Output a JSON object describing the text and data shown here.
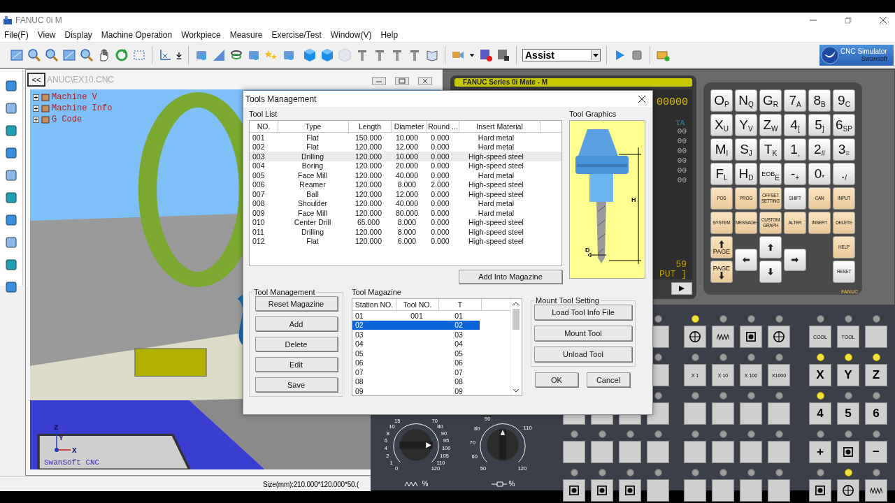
{
  "window": {
    "title": "FANUC 0i M"
  },
  "menu": [
    "File(F)",
    "View",
    "Display",
    "Machine Operation",
    "Workpiece",
    "Measure",
    "Exercise/Test",
    "Window(V)",
    "Help"
  ],
  "toolbar": {
    "mode_select": {
      "value": "Assist"
    },
    "logo": {
      "title": "CNC Simulator",
      "subtitle": "Swansoft"
    }
  },
  "view_window": {
    "back_button": "<<",
    "title": "ANUC\\EX10.CNC",
    "tree": [
      {
        "label": "Machine V"
      },
      {
        "label": "Machine Info"
      },
      {
        "label": "G Code"
      }
    ],
    "axis_labels": [
      "Z",
      "Y",
      "X"
    ],
    "viewport_logo": "SwanSoft CNC"
  },
  "status_bar": {
    "text": "Size(mm):210.000*120.000*50.("
  },
  "cnc_panel": {
    "screen": {
      "header": "FANUC Series 0i Mate - M",
      "program_no": "00000",
      "mode": "TA",
      "readings": [
        "00",
        "00",
        "00",
        "00",
        "00",
        "00"
      ],
      "count": "59",
      "prompt": "PUT ]"
    },
    "keys": [
      {
        "kind": "char",
        "main": "O",
        "sub": "P"
      },
      {
        "kind": "char",
        "main": "N",
        "sub": "Q"
      },
      {
        "kind": "char",
        "main": "G",
        "sub": "R"
      },
      {
        "kind": "char",
        "main": "7",
        "sub": "A"
      },
      {
        "kind": "char",
        "main": "8",
        "sub": "B"
      },
      {
        "kind": "char",
        "main": "9",
        "sub": "C"
      },
      {
        "kind": "char",
        "main": "X",
        "sub": "U"
      },
      {
        "kind": "char",
        "main": "Y",
        "sub": "V"
      },
      {
        "kind": "char",
        "main": "Z",
        "sub": "W"
      },
      {
        "kind": "char",
        "main": "4",
        "sub": "["
      },
      {
        "kind": "char",
        "main": "5",
        "sub": "]"
      },
      {
        "kind": "char",
        "main": "6",
        "sub": "SP"
      },
      {
        "kind": "char",
        "main": "M",
        "sub": "I"
      },
      {
        "kind": "char",
        "main": "S",
        "sub": "J"
      },
      {
        "kind": "char",
        "main": "T",
        "sub": "K"
      },
      {
        "kind": "char",
        "main": "1",
        "sub": ","
      },
      {
        "kind": "char",
        "main": "2",
        "sub": "#"
      },
      {
        "kind": "char",
        "main": "3",
        "sub": "="
      },
      {
        "kind": "char",
        "main": "F",
        "sub": "L"
      },
      {
        "kind": "char",
        "main": "H",
        "sub": "D"
      },
      {
        "kind": "char",
        "main": "EOB",
        "sub": "E"
      },
      {
        "kind": "char",
        "main": "-",
        "sub": "+"
      },
      {
        "kind": "char",
        "main": "0",
        "sub": "*"
      },
      {
        "kind": "char",
        "main": ".",
        "sub": "/"
      },
      {
        "kind": "func",
        "label": "POS"
      },
      {
        "kind": "func",
        "label": "PROG"
      },
      {
        "kind": "func",
        "label": "OFFSET SETTING"
      },
      {
        "kind": "plain",
        "label": "SHIFT"
      },
      {
        "kind": "func",
        "label": "CAN"
      },
      {
        "kind": "func",
        "label": "INPUT"
      },
      {
        "kind": "func",
        "label": "SYSTEM"
      },
      {
        "kind": "func",
        "label": "MESSAGE"
      },
      {
        "kind": "func",
        "label": "CUSTOM GRAPH"
      },
      {
        "kind": "func",
        "label": "ALTER"
      },
      {
        "kind": "func",
        "label": "INSERT"
      },
      {
        "kind": "func",
        "label": "DELETE"
      },
      {
        "kind": "page_up",
        "label": "PAGE"
      },
      {
        "kind": "arrow_left"
      },
      {
        "kind": "arrow_up"
      },
      {
        "kind": "arrow_right"
      },
      {
        "kind": "func",
        "label": "HELP"
      },
      {
        "kind": "page_down",
        "label": "PAGE"
      },
      {
        "kind": "arrow_down"
      },
      {
        "kind": "reset",
        "label": "RESET"
      }
    ],
    "brand": "FANUC"
  },
  "operator_panel": {
    "dials": [
      {
        "left_scale": [
          "15",
          "10",
          "8",
          "6",
          "4",
          "2",
          "1",
          "0"
        ],
        "right_scale": [
          "70",
          "80",
          "90",
          "95",
          "100",
          "105",
          "110",
          "120"
        ],
        "unit": "%"
      },
      {
        "left_scale": [
          "90",
          "80",
          "70",
          "60",
          "50"
        ],
        "right_scale": [
          "110",
          "120"
        ],
        "unit": "%"
      }
    ],
    "rows": [
      [
        {
          "kind": "icon",
          "lit": true
        },
        {
          "kind": "icon",
          "lit": false
        },
        {
          "kind": "icon",
          "lit": false
        },
        {
          "kind": "icon",
          "lit": false
        },
        {
          "kind": "text",
          "label": "COOL",
          "lit": false
        },
        {
          "kind": "text",
          "label": "TOOL",
          "lit": false
        },
        {
          "kind": "blank",
          "lit": false
        }
      ],
      [
        {
          "kind": "text",
          "label": "X  1",
          "lit": false
        },
        {
          "kind": "text",
          "label": "X  10",
          "lit": false
        },
        {
          "kind": "text",
          "label": "X  100",
          "lit": false
        },
        {
          "kind": "text",
          "label": "X1000",
          "lit": false
        },
        {
          "kind": "big",
          "label": "X",
          "lit": true
        },
        {
          "kind": "big",
          "label": "Y",
          "lit": true
        },
        {
          "kind": "big",
          "label": "Z",
          "lit": true
        }
      ],
      [
        {
          "kind": "blank",
          "lit": false
        },
        {
          "kind": "blank",
          "lit": false
        },
        {
          "kind": "blank",
          "lit": false
        },
        {
          "kind": "blank",
          "lit": false
        },
        {
          "kind": "big",
          "label": "4",
          "lit": true
        },
        {
          "kind": "big",
          "label": "5",
          "lit": false
        },
        {
          "kind": "big",
          "label": "6",
          "lit": false
        }
      ],
      [
        {
          "kind": "blank",
          "lit": false
        },
        {
          "kind": "blank",
          "lit": false
        },
        {
          "kind": "blank",
          "lit": false
        },
        {
          "kind": "blank",
          "lit": false
        },
        {
          "kind": "big",
          "label": "+",
          "lit": false
        },
        {
          "kind": "icon",
          "lit": false
        },
        {
          "kind": "big",
          "label": "−",
          "lit": false
        }
      ],
      [
        {
          "kind": "blank",
          "lit": false
        },
        {
          "kind": "blank",
          "lit": false
        },
        {
          "kind": "blank",
          "lit": false
        },
        {
          "kind": "blank",
          "lit": false
        },
        {
          "kind": "icon",
          "lit": false
        },
        {
          "kind": "icon",
          "lit": true
        },
        {
          "kind": "icon",
          "lit": false
        }
      ]
    ]
  },
  "dialog": {
    "title": "Tools Management",
    "tool_list": {
      "label": "Tool List",
      "columns": [
        "NO.",
        "Type",
        "Length",
        "Diameter",
        "Round ...",
        "Insert Material"
      ],
      "rows": [
        {
          "cells": [
            "001",
            "Flat",
            "150.000",
            "10.000",
            "0.000",
            "Hard metal"
          ],
          "selected": false
        },
        {
          "cells": [
            "002",
            "Flat",
            "120.000",
            "12.000",
            "0.000",
            "Hard metal"
          ],
          "selected": false
        },
        {
          "cells": [
            "003",
            "Drilling",
            "120.000",
            "10.000",
            "0.000",
            "High-speed steel"
          ],
          "selected": true
        },
        {
          "cells": [
            "004",
            "Boring",
            "120.000",
            "20.000",
            "0.000",
            "High-speed steel"
          ],
          "selected": false
        },
        {
          "cells": [
            "005",
            "Face Mill",
            "120.000",
            "40.000",
            "0.000",
            "Hard metal"
          ],
          "selected": false
        },
        {
          "cells": [
            "006",
            "Reamer",
            "120.000",
            "8.000",
            "2.000",
            "High-speed steel"
          ],
          "selected": false
        },
        {
          "cells": [
            "007",
            "Ball",
            "120.000",
            "12.000",
            "0.000",
            "High-speed steel"
          ],
          "selected": false
        },
        {
          "cells": [
            "008",
            "Shoulder",
            "120.000",
            "40.000",
            "0.000",
            "Hard metal"
          ],
          "selected": false
        },
        {
          "cells": [
            "009",
            "Face Mill",
            "120.000",
            "80.000",
            "0.000",
            "Hard metal"
          ],
          "selected": false
        },
        {
          "cells": [
            "010",
            "Center Drill",
            "65.000",
            "8.000",
            "0.000",
            "High-speed steel"
          ],
          "selected": false
        },
        {
          "cells": [
            "011",
            "Drilling",
            "120.000",
            "8.000",
            "0.000",
            "High-speed steel"
          ],
          "selected": false
        },
        {
          "cells": [
            "012",
            "Flat",
            "120.000",
            "6.000",
            "0.000",
            "High-speed steel"
          ],
          "selected": false
        }
      ]
    },
    "tool_graphics": {
      "label": "Tool Graphics",
      "dimension_labels": [
        "H",
        "D"
      ]
    },
    "add_button": "Add Into Magazine",
    "tool_management": {
      "label": "Tool Management",
      "buttons": [
        "Reset Magazine",
        "Add",
        "Delete",
        "Edit",
        "Save"
      ]
    },
    "tool_magazine": {
      "label": "Tool Magazine",
      "columns": [
        "Station NO.",
        "Tool NO.",
        "T"
      ],
      "rows": [
        {
          "station": "01",
          "tool": "001",
          "t": "01",
          "selected": false
        },
        {
          "station": "02",
          "tool": "",
          "t": "02",
          "selected": true
        },
        {
          "station": "03",
          "tool": "",
          "t": "03",
          "selected": false
        },
        {
          "station": "04",
          "tool": "",
          "t": "04",
          "selected": false
        },
        {
          "station": "05",
          "tool": "",
          "t": "05",
          "selected": false
        },
        {
          "station": "06",
          "tool": "",
          "t": "06",
          "selected": false
        },
        {
          "station": "07",
          "tool": "",
          "t": "07",
          "selected": false
        },
        {
          "station": "08",
          "tool": "",
          "t": "08",
          "selected": false
        },
        {
          "station": "09",
          "tool": "",
          "t": "09",
          "selected": false
        }
      ]
    },
    "mount_tool_setting": {
      "label": "Mount Tool Setting",
      "buttons": [
        "Load Tool Info File",
        "Mount Tool",
        "Unload Tool"
      ]
    },
    "buttons": [
      "OK",
      "Cancel"
    ]
  }
}
